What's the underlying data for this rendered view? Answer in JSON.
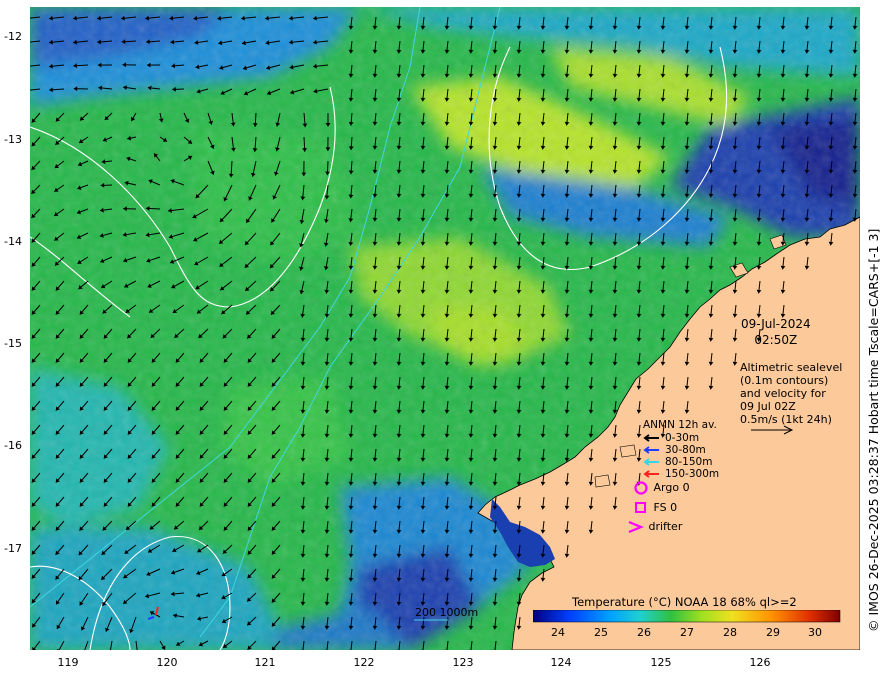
{
  "map": {
    "lat_ticks": [
      "-12",
      "-13",
      "-14",
      "-15",
      "-16",
      "-17"
    ],
    "lon_ticks": [
      "119",
      "120",
      "121",
      "122",
      "123",
      "124",
      "125",
      "126"
    ],
    "lon_range": [
      118.6,
      127.1
    ],
    "lat_range": [
      -11.7,
      -18.0
    ]
  },
  "annotation": {
    "date": "09-Jul-2024",
    "time": "02:50Z",
    "alti_lines": [
      "Altimetric sealevel",
      "(0.1m contours)",
      "and velocity for",
      "09 Jul 02Z",
      "0.5m/s (1kt 24h)"
    ]
  },
  "legend": {
    "title": "ANMN 12h av.",
    "items": [
      {
        "label": "0-30m",
        "color": "#000000"
      },
      {
        "label": "30-80m",
        "color": "#1f3fff"
      },
      {
        "label": "80-150m",
        "color": "#33d6e8"
      },
      {
        "label": "150-300m",
        "color": "#ff2020"
      }
    ],
    "argo": "Argo 0",
    "fs": "FS 0",
    "drifter": "drifter",
    "marker_color": "#ff00ff"
  },
  "colorbar": {
    "title": "Temperature (°C) NOAA 18 68% ql>=2",
    "ticks": [
      "24",
      "25",
      "26",
      "27",
      "28",
      "29",
      "30"
    ]
  },
  "depth_contours": "200  1000m",
  "credit": "© IMOS 26-Dec-2025 03:28:37 Hobart time Tscale=CARS+[-1 3]",
  "colors": {
    "land": "#fbc99a",
    "contour": "#ffffff",
    "isobath": "#3fd7e0"
  }
}
